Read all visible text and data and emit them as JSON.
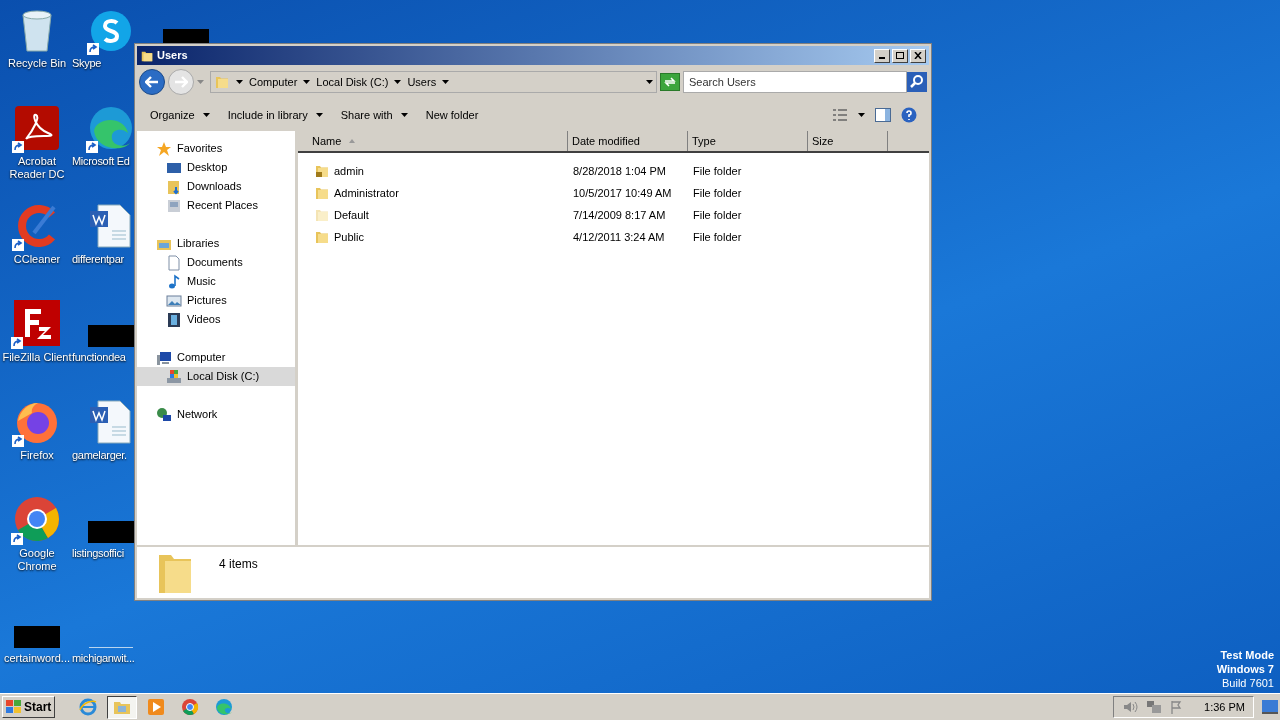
{
  "desktop_icons": [
    {
      "label": "Recycle Bin",
      "kind": "recycle"
    },
    {
      "label": "Skype",
      "kind": "skype"
    },
    {
      "label": "Acrobat Reader DC",
      "kind": "acrobat"
    },
    {
      "label": "Microsoft Ed",
      "kind": "edge"
    },
    {
      "label": "CCleaner",
      "kind": "ccleaner"
    },
    {
      "label": "differentpar",
      "kind": "word"
    },
    {
      "label": "FileZilla Client",
      "kind": "filezilla"
    },
    {
      "label": "functiondea",
      "kind": "redacted"
    },
    {
      "label": "Firefox",
      "kind": "firefox"
    },
    {
      "label": "gamelarger.",
      "kind": "word"
    },
    {
      "label": "Google Chrome",
      "kind": "chrome"
    },
    {
      "label": "listingsoffici",
      "kind": "redacted"
    },
    {
      "label": "certainword...",
      "kind": "redacted"
    },
    {
      "label": "michiganwit...",
      "kind": "blank"
    }
  ],
  "partial_icon": {
    "kind": "redacted"
  },
  "window": {
    "title": "Users",
    "address": {
      "crumbs": [
        "Computer",
        "Local Disk (C:)",
        "Users"
      ]
    },
    "search": {
      "placeholder": "Search Users"
    },
    "toolbar": [
      {
        "label": "Organize",
        "dropdown": true
      },
      {
        "label": "Include in library",
        "dropdown": true
      },
      {
        "label": "Share with",
        "dropdown": true
      },
      {
        "label": "New folder",
        "dropdown": false
      }
    ],
    "nav": [
      {
        "label": "Favorites",
        "kind": "star",
        "selected": false,
        "children": [
          {
            "label": "Desktop",
            "kind": "desktop",
            "selected": false
          },
          {
            "label": "Downloads",
            "kind": "downloads",
            "selected": false
          },
          {
            "label": "Recent Places",
            "kind": "recent",
            "selected": false
          }
        ]
      },
      {
        "label": "Libraries",
        "kind": "library",
        "selected": false,
        "children": [
          {
            "label": "Documents",
            "kind": "document",
            "selected": false
          },
          {
            "label": "Music",
            "kind": "music",
            "selected": false
          },
          {
            "label": "Pictures",
            "kind": "pictures",
            "selected": false
          },
          {
            "label": "Videos",
            "kind": "videos",
            "selected": false
          }
        ]
      },
      {
        "label": "Computer",
        "kind": "computer",
        "selected": false,
        "children": [
          {
            "label": "Local Disk (C:)",
            "kind": "disk",
            "selected": true
          }
        ]
      },
      {
        "label": "Network",
        "kind": "network",
        "selected": false
      }
    ],
    "columns": [
      {
        "label": "Name",
        "sorted": true
      },
      {
        "label": "Date modified",
        "sorted": false
      },
      {
        "label": "Type",
        "sorted": false
      },
      {
        "label": "Size",
        "sorted": false
      }
    ],
    "rows": [
      {
        "name": "admin",
        "date": "8/28/2018 1:04 PM",
        "type": "File folder",
        "kind": "locked"
      },
      {
        "name": "Administrator",
        "date": "10/5/2017 10:49 AM",
        "type": "File folder",
        "kind": "folder"
      },
      {
        "name": "Default",
        "date": "7/14/2009 8:17 AM",
        "type": "File folder",
        "kind": "hidden"
      },
      {
        "name": "Public",
        "date": "4/12/2011 3:24 AM",
        "type": "File folder",
        "kind": "folder"
      }
    ],
    "status": {
      "count": "4 items"
    }
  },
  "os_notice": [
    "Test Mode",
    "Windows 7",
    "Build 7601"
  ],
  "taskbar": {
    "start": "Start",
    "apps": [
      {
        "kind": "ie",
        "selected": false
      },
      {
        "kind": "explorer",
        "selected": true
      },
      {
        "kind": "media",
        "selected": false
      },
      {
        "kind": "chrome",
        "selected": false
      },
      {
        "kind": "edge",
        "selected": false
      }
    ],
    "clock": "1:36 PM"
  }
}
